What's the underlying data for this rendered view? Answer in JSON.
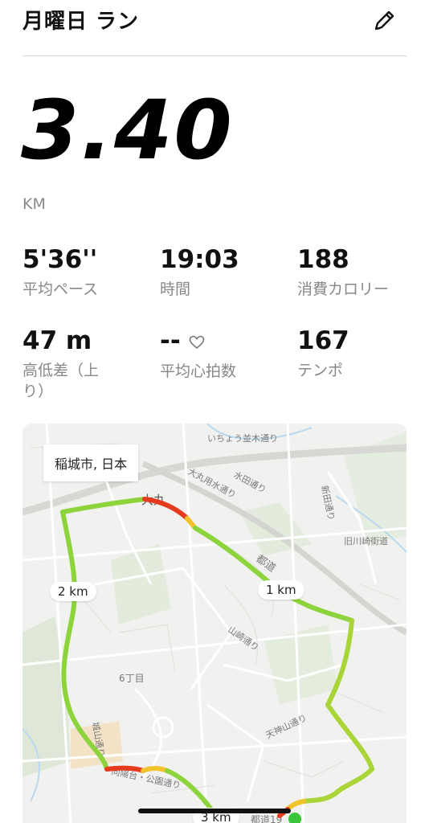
{
  "header": {
    "title": "月曜日 ラン",
    "edit_icon": "pencil-icon"
  },
  "summary": {
    "distance": "3.40",
    "unit": "KM"
  },
  "stats": [
    {
      "value": "5'36''",
      "label": "平均ペース"
    },
    {
      "value": "19:03",
      "label": "時間"
    },
    {
      "value": "188",
      "label": "消費カロリー"
    },
    {
      "value": "47 m",
      "label": "高低差（上り）"
    },
    {
      "value": "--",
      "label": "平均心拍数",
      "icon": "heart-icon"
    },
    {
      "value": "167",
      "label": "テンポ"
    }
  ],
  "map": {
    "location": "稲城市, 日本",
    "markers": {
      "km1": "1 km",
      "km2": "2 km",
      "km3": "3 km"
    },
    "places": [
      "いちょう並木通り",
      "大丸",
      "大丸用水通り",
      "水田通り",
      "新田通り",
      "旧川崎街道",
      "都道",
      "山崎通り",
      "6丁目",
      "天神山通り",
      "城山通り",
      "向陽台・公園通り",
      "都道19"
    ],
    "colors": {
      "route_good": "#8dd43c",
      "route_mid": "#f2c22a",
      "route_slow": "#e63a1e"
    }
  }
}
